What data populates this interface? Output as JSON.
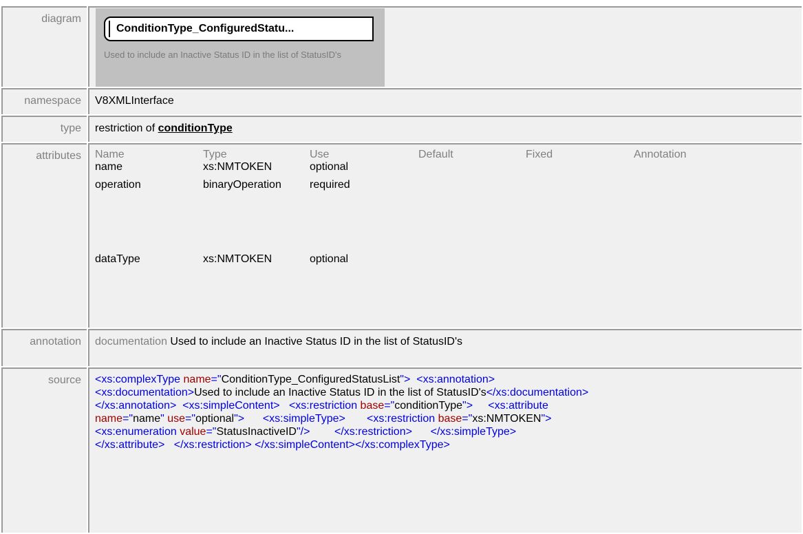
{
  "labels": {
    "diagram": "diagram",
    "namespace": "namespace",
    "type": "type",
    "attributes": "attributes",
    "annotation": "annotation",
    "source": "source"
  },
  "diagram": {
    "name": "ConditionType_ConfiguredStatu...",
    "documentation": "Used to include an Inactive Status ID in the list of StatusID's"
  },
  "namespace": "V8XMLInterface",
  "type": {
    "prefix": "restriction of",
    "base": "conditionType"
  },
  "attributes": {
    "headers": [
      "Name",
      "Type",
      "Use",
      "Default",
      "Fixed",
      "Annotation"
    ],
    "rows": [
      {
        "name": "name",
        "type": "xs:NMTOKEN",
        "use": "optional",
        "default": "",
        "fixed": "",
        "annotation": ""
      },
      {
        "name": "operation",
        "type": "binaryOperation",
        "use": "required",
        "default": "",
        "fixed": "",
        "annotation": ""
      },
      {
        "name": "dataType",
        "type": "xs:NMTOKEN",
        "use": "optional",
        "default": "",
        "fixed": "",
        "annotation": ""
      }
    ]
  },
  "annotation": {
    "key": "documentation",
    "text": "Used to include an Inactive Status ID in the list of StatusID's"
  },
  "source": {
    "l1_tag1": "<xs:complexType",
    "l1_attr1": "name",
    "l1_eq1": "=\"",
    "l1_val1": "ConditionType_ConfiguredStatusList",
    "l1_close1": "\">",
    "l1_tag2": "<xs:annotation>",
    "l2_tag1": "<xs:documentation>",
    "l2_text": "Used to include an Inactive Status ID in the list of StatusID's",
    "l2_tag2": "</xs:documentation>",
    "l3_tag1": "</xs:annotation>",
    "l3_tag2": "<xs:simpleContent>",
    "l3_tag3": "<xs:restriction",
    "l3_attr1": "base",
    "l3_eq1": "=\"",
    "l3_val1": "conditionType",
    "l3_close1": "\">",
    "l3_tag4": "<xs:attribute",
    "l4_attr1": "name",
    "l4_eq1": "=\"",
    "l4_val1": "name",
    "l4_q1": "\"",
    "l4_attr2": "use",
    "l4_eq2": "=\"",
    "l4_val2": "optional",
    "l4_close2": "\">",
    "l4_tag1": "<xs:simpleType>",
    "l4_tag2": "<xs:restriction",
    "l4_attr3": "base",
    "l4_eq3": "=\"",
    "l4_val3": "xs:NMTOKEN",
    "l4_close3": "\">",
    "l5_tag1": "<xs:enumeration",
    "l5_attr1": "value",
    "l5_eq1": "=\"",
    "l5_val1": "StatusInactiveID",
    "l5_close1": "\"/>",
    "l5_tag2": "</xs:restriction>",
    "l5_tag3": "</xs:simpleType>",
    "l6_tag1": "</xs:attribute>",
    "l6_tag2": "</xs:restriction>",
    "l6_tag3": "</xs:simpleContent>",
    "l6_tag4": "</xs:complexType>"
  },
  "colors": {
    "label_bg": "#f0f0f0",
    "label_text": "#808080",
    "diagram_bg": "#c0c0c0",
    "xml_tag": "#0000e0",
    "xml_attr": "#a00000",
    "border": "#9a9a9a"
  }
}
